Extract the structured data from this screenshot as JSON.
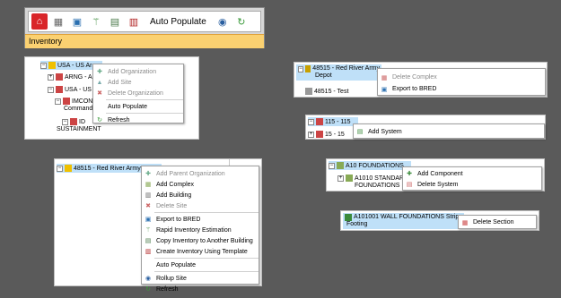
{
  "toolbar": {
    "auto_populate": "Auto Populate",
    "inventory_label": "Inventory",
    "icons": [
      "home-icon",
      "building-icon",
      "image-icon",
      "estimate-icon",
      "copy-icon",
      "template-icon",
      "rollup-icon",
      "refresh-icon"
    ],
    "colors": {
      "accent": "#fbd171",
      "home": "#d9262a"
    }
  },
  "panel1": {
    "tree": {
      "root": "USA - US Army",
      "child1": "ARNG - Ar",
      "child2": "USA - US A",
      "child3": "IMCON",
      "child3b": "Command",
      "child4": "ID",
      "child4b": "SUSTAINMENT"
    },
    "menu": {
      "add_org": "Add Organization",
      "add_site": "Add Site",
      "delete_org": "Delete Organization",
      "auto_populate": "Auto Populate",
      "refresh": "Refresh"
    }
  },
  "panel2": {
    "tree": {
      "node": "48515 - Red River Army Depot"
    },
    "menu": {
      "add_parent_org": "Add Parent Organization",
      "add_complex": "Add Complex",
      "add_building": "Add Building",
      "delete_site": "Delete Site",
      "export_bred": "Export to BRED",
      "rapid_estimation": "Rapid Inventory Estimation",
      "copy_inventory": "Copy Inventory to Another Building",
      "create_inventory": "Create Inventory Using Template",
      "auto_populate": "Auto Populate",
      "rollup_site": "Rollup Site",
      "refresh": "Refresh"
    }
  },
  "panel3": {
    "tree": {
      "node_line1": "48515 - Red River Army",
      "node_line2": "Depot",
      "child": "48515 - Test"
    },
    "menu": {
      "delete_complex": "Delete Complex",
      "export_bred": "Export to BRED"
    }
  },
  "panel4": {
    "tree": {
      "node": "115 - 115",
      "child": "15 - 15"
    },
    "menu": {
      "add_system": "Add System"
    }
  },
  "panel5": {
    "tree": {
      "node": "A10 FOUNDATIONS",
      "child_line1": "A1010 STANDAR",
      "child_line2": "FOUNDATIONS"
    },
    "menu": {
      "add_component": "Add Component",
      "delete_system": "Delete System"
    }
  },
  "panel6": {
    "tree": {
      "node_line1": "A101001 WALL FOUNDATIONS Strip",
      "node_line2": "Footing"
    },
    "menu": {
      "delete_section": "Delete Section"
    }
  }
}
